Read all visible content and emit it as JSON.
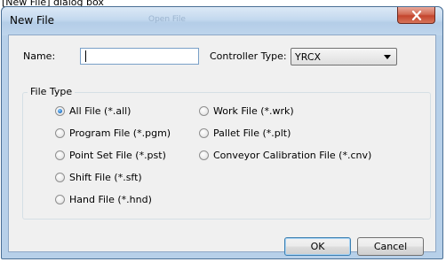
{
  "caption": "[New File] dialog box",
  "window": {
    "title": "New File",
    "background_text": "Open File"
  },
  "form": {
    "name_label": "Name:",
    "name_value": "",
    "controller_type_label": "Controller Type:",
    "controller_type_value": "YRCX"
  },
  "file_type": {
    "legend": "File Type",
    "options": [
      {
        "label": "All File (*.all)",
        "selected": true
      },
      {
        "label": "Work File (*.wrk)",
        "selected": false
      },
      {
        "label": "Program File (*.pgm)",
        "selected": false
      },
      {
        "label": "Pallet File (*.plt)",
        "selected": false
      },
      {
        "label": "Point Set File (*.pst)",
        "selected": false
      },
      {
        "label": "Conveyor Calibration File (*.cnv)",
        "selected": false
      },
      {
        "label": "Shift File (*.sft)",
        "selected": false
      },
      {
        "label": "Hand File (*.hnd)",
        "selected": false
      }
    ]
  },
  "buttons": {
    "ok": "OK",
    "cancel": "Cancel"
  },
  "colors": {
    "accent": "#3c7fb1",
    "close_button": "#c4452d"
  }
}
